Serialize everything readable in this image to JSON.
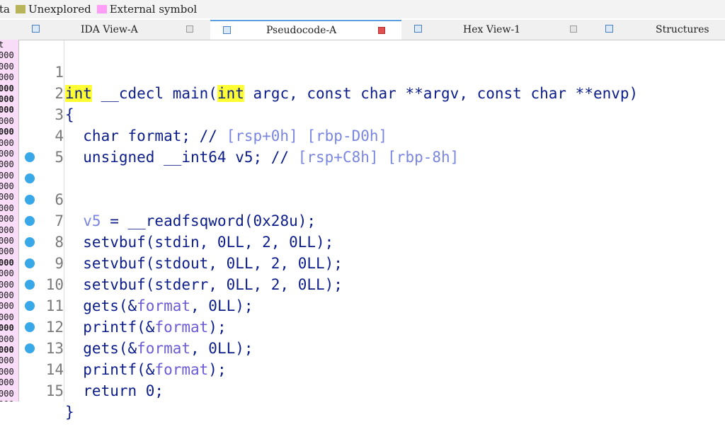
{
  "legend": {
    "prefix": "ta",
    "items": [
      {
        "label": "Unexplored",
        "color": "#b8b45a"
      },
      {
        "label": "External symbol",
        "color": "#ff9cf5"
      }
    ]
  },
  "left_panel": {
    "close_glyph": "×",
    "header": "t",
    "rows": [
      "000",
      "000",
      "000",
      "000",
      "000",
      "000",
      "000",
      "000",
      "000",
      "000",
      "000",
      "000",
      "000",
      "000",
      "000",
      "000",
      "000",
      "000",
      "000",
      "000",
      "000",
      "000",
      "000",
      "000",
      "000",
      "000",
      "000",
      "000",
      "000",
      "000",
      "000",
      "000",
      "000"
    ]
  },
  "tabs": [
    {
      "label": "IDA View-A",
      "active": false
    },
    {
      "label": "Pseudocode-A",
      "active": true
    },
    {
      "label": "Hex View-1",
      "active": false
    },
    {
      "label": "Structures",
      "active": false
    }
  ],
  "code": {
    "lines": [
      {
        "num": "1",
        "text": ""
      },
      {
        "num": "2",
        "text": "{"
      },
      {
        "num": "3",
        "text": ""
      },
      {
        "num": "4",
        "text": ""
      },
      {
        "num": "5",
        "text": ""
      },
      {
        "num": "6",
        "text": ""
      },
      {
        "num": "7",
        "text": "  setvbuf(stdin, 0LL, 2, 0LL);"
      },
      {
        "num": "8",
        "text": "  setvbuf(stdout, 0LL, 2, 0LL);"
      },
      {
        "num": "9",
        "text": "  setvbuf(stderr, 0LL, 2, 0LL);"
      },
      {
        "num": "10",
        "text": ""
      },
      {
        "num": "11",
        "text": ""
      },
      {
        "num": "12",
        "text": ""
      },
      {
        "num": "13",
        "text": ""
      },
      {
        "num": "14",
        "text": "  return 0;"
      },
      {
        "num": "15",
        "text": "}"
      }
    ],
    "line1": {
      "kw": "int",
      "mid": " __cdecl main(",
      "kw2": "int",
      "rest": " argc, const char **argv, const char **envp)"
    },
    "line3": {
      "decl": "  char format; // ",
      "cmt": "[rsp+0h] [rbp-D0h]"
    },
    "line4": {
      "decl": "  unsigned __int64 v5; // ",
      "cmt": "[rsp+C8h] [rbp-8h]"
    },
    "line6": {
      "var": "  v5",
      "rest": " = __readfsqword(0x28u);"
    },
    "line10": {
      "a": "  gets(&",
      "v": "format",
      "b": ", 0LL);"
    },
    "line11": {
      "a": "  printf(&",
      "v": "format",
      "b": ");"
    },
    "line12": {
      "a": "  gets(&",
      "v": "format",
      "b": ", 0LL);"
    },
    "line13": {
      "a": "  printf(&",
      "v": "format",
      "b": ");"
    },
    "breakpoint_lines": [
      "6",
      "7",
      "8",
      "9",
      "10",
      "11",
      "12",
      "13",
      "14",
      "15"
    ],
    "colors": {
      "keyword_highlight": "#ffff33",
      "breakpoint_dot": "#38a8e8",
      "code": "#0c1d8a",
      "comment": "#7a86e0"
    }
  }
}
